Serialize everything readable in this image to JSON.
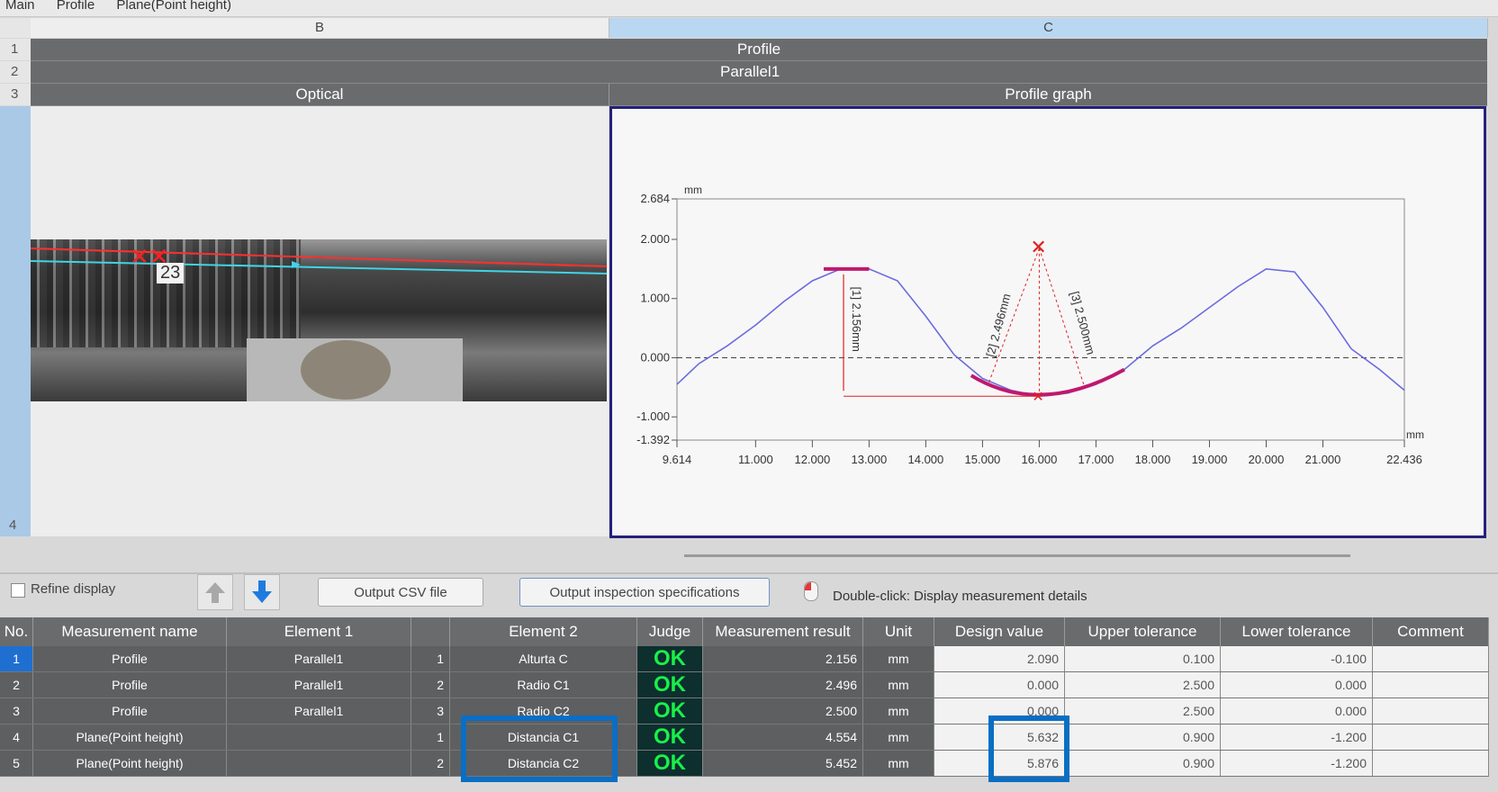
{
  "tabs": [
    "Main",
    "Profile",
    "Plane(Point height)"
  ],
  "columns": [
    "B",
    "C"
  ],
  "row_numbers": [
    "1",
    "2",
    "3",
    "4"
  ],
  "rows": {
    "r1": "Profile",
    "r2": "Parallel1",
    "r3_left": "Optical",
    "r3_right": "Profile graph"
  },
  "optical": {
    "marker_label": "23"
  },
  "chart_data": {
    "type": "line",
    "xlabel": "mm",
    "ylabel": "mm",
    "xlim": [
      9.614,
      22.436
    ],
    "ylim": [
      -1.392,
      2.684
    ],
    "x_ticks": [
      "9.614",
      "11.000",
      "12.000",
      "13.000",
      "14.000",
      "15.000",
      "16.000",
      "17.000",
      "18.000",
      "19.000",
      "20.000",
      "21.000",
      "22.436"
    ],
    "y_ticks": [
      "2.684",
      "2.000",
      "1.000",
      "0.000",
      "-1.000",
      "-1.392"
    ],
    "series": [
      {
        "x": [
          9.614,
          10.0,
          10.5,
          11.0,
          11.5,
          12.0,
          12.5,
          13.0,
          13.5,
          14.0,
          14.5,
          15.0,
          15.5,
          16.0,
          16.5,
          17.0,
          17.5,
          18.0,
          18.5,
          19.0,
          19.5,
          20.0,
          20.5,
          21.0,
          21.5,
          22.0,
          22.436
        ],
        "y": [
          -0.45,
          -0.1,
          0.2,
          0.55,
          0.95,
          1.3,
          1.5,
          1.5,
          1.3,
          0.7,
          0.05,
          -0.35,
          -0.55,
          -0.65,
          -0.6,
          -0.45,
          -0.2,
          0.2,
          0.5,
          0.85,
          1.2,
          1.5,
          1.45,
          0.85,
          0.15,
          -0.2,
          -0.55
        ]
      }
    ],
    "annotations": [
      "[1] 2.156mm",
      "[2] 2.496mm",
      "[3] 2.500mm"
    ],
    "annotation_points": {
      "peak_top_y": 1.5,
      "bottom_x": 16.0,
      "bottom_y": -0.65,
      "center_x": 16.0,
      "center_y": 1.85
    }
  },
  "toolbar": {
    "refine_label": "Refine display",
    "csv_label": "Output CSV file",
    "spec_label": "Output inspection specifications",
    "hint": "Double-click: Display measurement details"
  },
  "table": {
    "headers": [
      "No.",
      "Measurement name",
      "Element 1",
      "",
      "Element 2",
      "Judge",
      "Measurement result",
      "Unit",
      "Design value",
      "Upper tolerance",
      "Lower tolerance",
      "Comment"
    ],
    "rows": [
      {
        "no": "1",
        "name": "Profile",
        "el1": "Parallel1",
        "idx": "1",
        "el2": "Alturta C",
        "judge": "OK",
        "result": "2.156",
        "unit": "mm",
        "design": "2.090",
        "upper": "0.100",
        "lower": "-0.100",
        "comment": ""
      },
      {
        "no": "2",
        "name": "Profile",
        "el1": "Parallel1",
        "idx": "2",
        "el2": "Radio C1",
        "judge": "OK",
        "result": "2.496",
        "unit": "mm",
        "design": "0.000",
        "upper": "2.500",
        "lower": "0.000",
        "comment": ""
      },
      {
        "no": "3",
        "name": "Profile",
        "el1": "Parallel1",
        "idx": "3",
        "el2": "Radio C2",
        "judge": "OK",
        "result": "2.500",
        "unit": "mm",
        "design": "0.000",
        "upper": "2.500",
        "lower": "0.000",
        "comment": ""
      },
      {
        "no": "4",
        "name": "Plane(Point height)",
        "el1": "",
        "idx": "1",
        "el2": "Distancia C1",
        "judge": "OK",
        "result": "4.554",
        "unit": "mm",
        "design": "5.632",
        "upper": "0.900",
        "lower": "-1.200",
        "comment": ""
      },
      {
        "no": "5",
        "name": "Plane(Point height)",
        "el1": "",
        "idx": "2",
        "el2": "Distancia C2",
        "judge": "OK",
        "result": "5.452",
        "unit": "mm",
        "design": "5.876",
        "upper": "0.900",
        "lower": "-1.200",
        "comment": ""
      }
    ]
  }
}
